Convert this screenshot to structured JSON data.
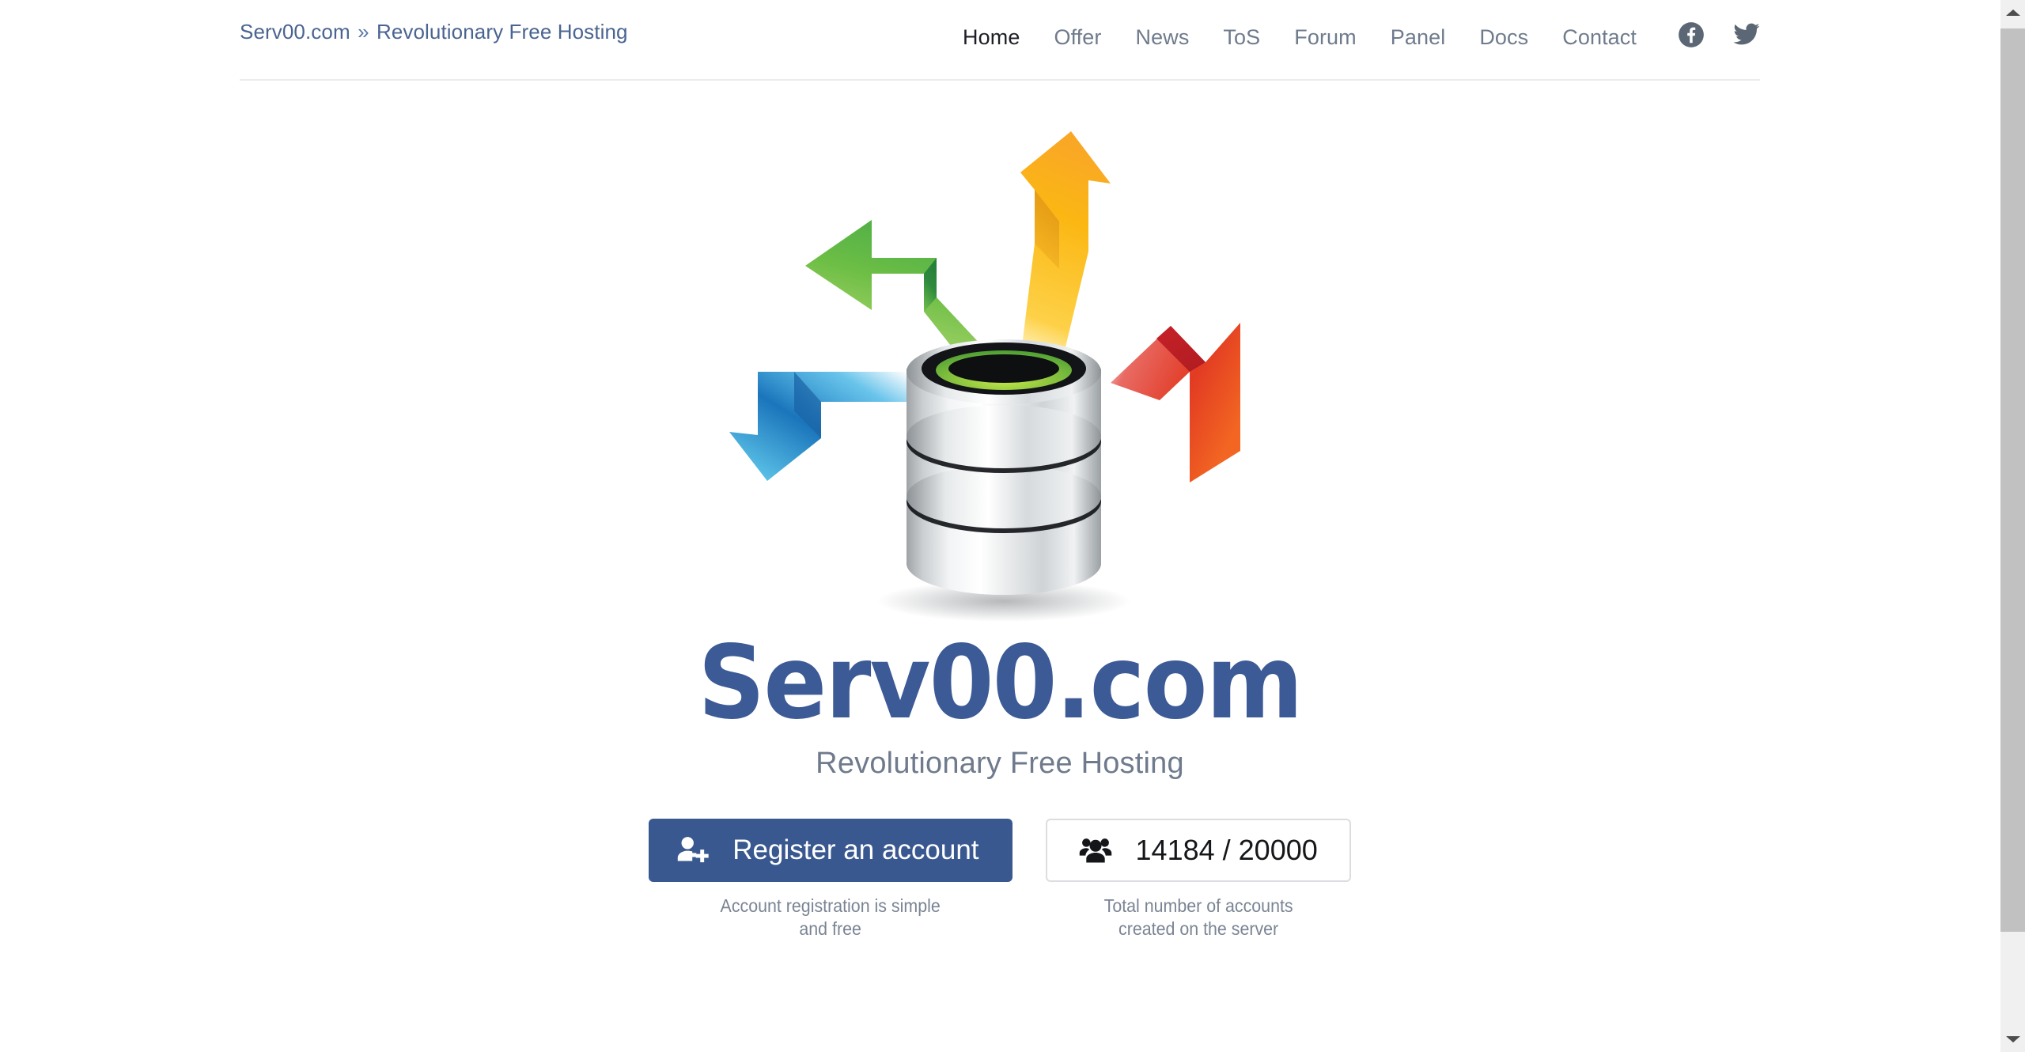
{
  "breadcrumb": {
    "site": "Serv00.com",
    "separator": "»",
    "current": "Revolutionary Free Hosting"
  },
  "nav": {
    "items": [
      {
        "label": "Home",
        "active": true
      },
      {
        "label": "Offer",
        "active": false
      },
      {
        "label": "News",
        "active": false
      },
      {
        "label": "ToS",
        "active": false
      },
      {
        "label": "Forum",
        "active": false
      },
      {
        "label": "Panel",
        "active": false
      },
      {
        "label": "Docs",
        "active": false
      },
      {
        "label": "Contact",
        "active": false
      }
    ],
    "social": [
      {
        "icon": "facebook-icon"
      },
      {
        "icon": "twitter-icon"
      }
    ]
  },
  "hero": {
    "illustration": {
      "icon": "database-cylinder-with-arrows-icon",
      "cylinder_rim_color": "#76c043",
      "arrows": [
        {
          "name": "arrow-up-left-green",
          "color_from": "#8cc63f",
          "color_to": "#3fae49",
          "direction": "up-left"
        },
        {
          "name": "arrow-up-right-yellow",
          "color_from": "#fdb913",
          "color_to": "#f7941e",
          "direction": "up-right"
        },
        {
          "name": "arrow-down-right-red",
          "color_from": "#e03127",
          "color_to": "#f26522",
          "direction": "down-right"
        },
        {
          "name": "arrow-down-left-blue",
          "color_from": "#1b75bb",
          "color_to": "#5bc2e7",
          "direction": "down-left"
        }
      ]
    },
    "logo_text": "Serv00.com",
    "tagline": "Revolutionary Free Hosting"
  },
  "actions": {
    "register": {
      "icon": "user-plus-icon",
      "label": "Register an account",
      "caption_line1": "Account registration is simple",
      "caption_line2": "and free"
    },
    "counter": {
      "icon": "users-icon",
      "current": "14184",
      "separator": "/",
      "total": "20000",
      "value": "14184 / 20000",
      "caption_line1": "Total number of accounts",
      "caption_line2": "created on the server"
    }
  },
  "colors": {
    "brand_blue": "#3c5a96",
    "button_blue": "#39588f",
    "muted_text": "#6f7b8c",
    "link_blue": "#4a6491",
    "rule": "#ececee"
  },
  "scrollbar": {
    "up_icon": "scroll-up-arrow-icon",
    "down_icon": "scroll-down-arrow-icon"
  }
}
